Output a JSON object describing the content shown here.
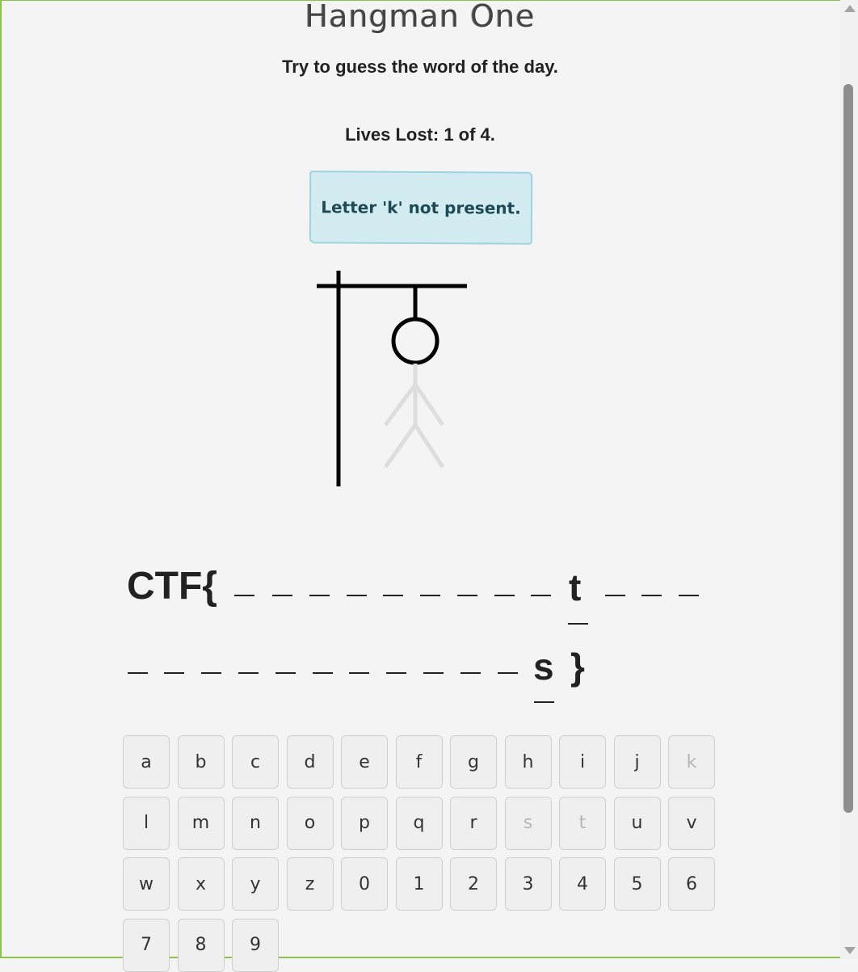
{
  "header": {
    "title": "Hangman One",
    "subtitle": "Try to guess the word of the day."
  },
  "status": {
    "lives_lost": "Lives Lost: 1 of 4.",
    "message": "Letter 'k' not present."
  },
  "puzzle": {
    "line1_prefix": "CTF{",
    "line1_revealed": "t",
    "line2_revealed": "s",
    "line2_suffix": "}"
  },
  "keyboard": {
    "keys": [
      "a",
      "b",
      "c",
      "d",
      "e",
      "f",
      "g",
      "h",
      "i",
      "j",
      "k",
      "l",
      "m",
      "n",
      "o",
      "p",
      "q",
      "r",
      "s",
      "t",
      "u",
      "v",
      "w",
      "x",
      "y",
      "z",
      "0",
      "1",
      "2",
      "3",
      "4",
      "5",
      "6",
      "7",
      "8",
      "9"
    ],
    "used": [
      "k",
      "s",
      "t"
    ]
  },
  "colors": {
    "alert_bg": "#d2ecf1",
    "frame_border": "#8bc34a",
    "body_drawn": "#dddddd"
  }
}
